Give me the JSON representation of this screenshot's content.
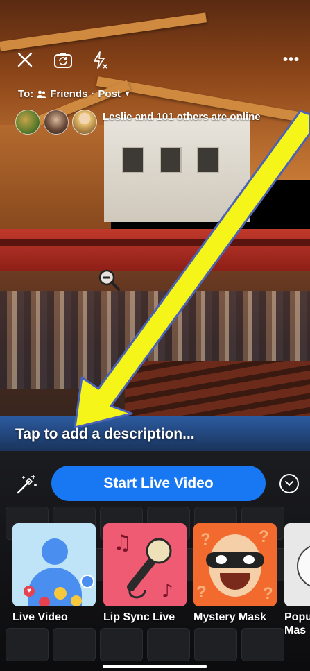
{
  "top_bar": {
    "close_icon": "close-icon",
    "flip_icon": "camera-flip-icon",
    "flash_icon": "flash-off-icon",
    "more_label": "•••"
  },
  "audience": {
    "to_label": "To:",
    "audience_label": "Friends",
    "separator": "·",
    "post_label": "Post",
    "caret": "▾"
  },
  "online": {
    "text": "Leslie and 101 others are online"
  },
  "description": {
    "placeholder": "Tap to add a description..."
  },
  "actions": {
    "start_label": "Start Live Video",
    "start_color": "#1877f2"
  },
  "effects": [
    {
      "label": "Live Video"
    },
    {
      "label": "Lip Sync Live"
    },
    {
      "label": "Mystery Mask"
    },
    {
      "label": "Popu Mas"
    }
  ],
  "colors": {
    "arrow_fill": "#f5f51a",
    "arrow_stroke": "#4a62b8"
  }
}
